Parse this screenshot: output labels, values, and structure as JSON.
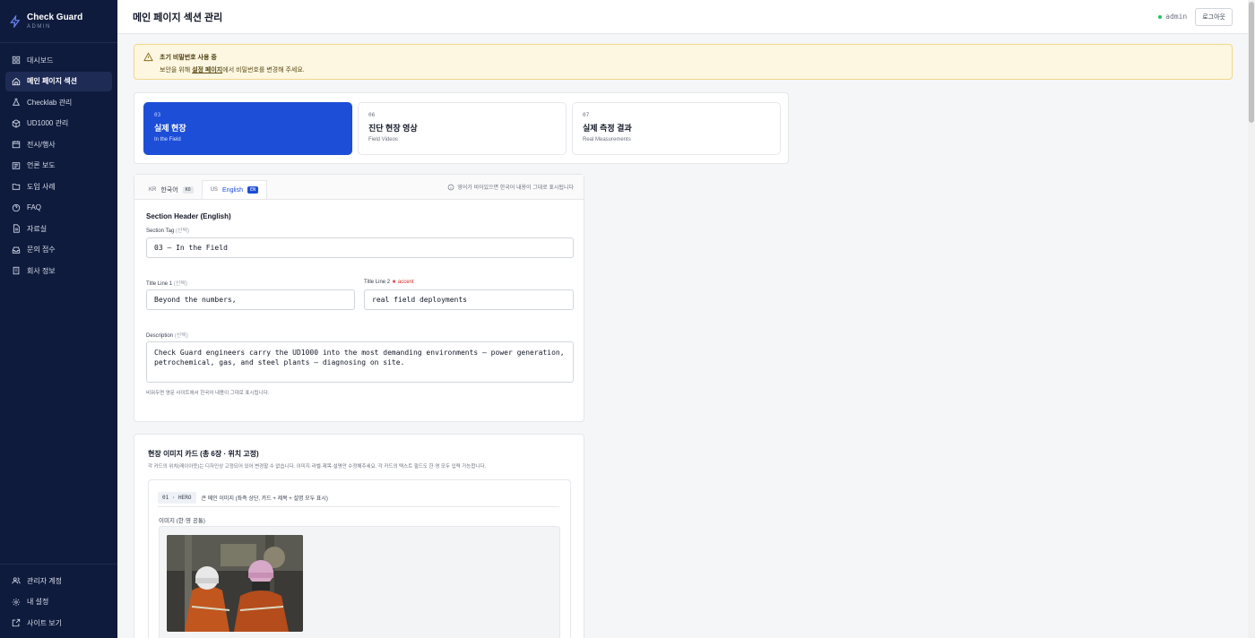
{
  "brand": {
    "name": "Check Guard",
    "role": "ADMIN"
  },
  "sidebar": {
    "items": [
      {
        "label": "대시보드",
        "icon": "dashboard-icon"
      },
      {
        "label": "메인 페이지 섹션",
        "icon": "home-icon",
        "active": true
      },
      {
        "label": "Checklab 관리",
        "icon": "flask-icon"
      },
      {
        "label": "UD1000 관리",
        "icon": "box-icon"
      },
      {
        "label": "전시/행사",
        "icon": "calendar-icon"
      },
      {
        "label": "언론 보도",
        "icon": "newspaper-icon"
      },
      {
        "label": "도입 사례",
        "icon": "folder-icon"
      },
      {
        "label": "FAQ",
        "icon": "help-circle-icon"
      },
      {
        "label": "자료실",
        "icon": "file-icon"
      },
      {
        "label": "문의 접수",
        "icon": "inbox-icon"
      },
      {
        "label": "회사 정보",
        "icon": "building-icon"
      }
    ],
    "bottom": [
      {
        "label": "관리자 계정",
        "icon": "users-icon"
      },
      {
        "label": "내 설정",
        "icon": "gear-icon"
      },
      {
        "label": "사이트 보기",
        "icon": "external-link-icon"
      }
    ]
  },
  "header": {
    "title": "메인 페이지 섹션 관리",
    "user": "admin",
    "logout": "로그아웃"
  },
  "alert": {
    "title": "초기 비밀번호 사용 중",
    "text_before": "보안을 위해 ",
    "link": "설정 페이지",
    "text_after": "에서 비밀번호를 변경해 주세요."
  },
  "section_tabs": [
    {
      "num": "03",
      "title": "실제 현장",
      "sub": "In the Field",
      "active": true
    },
    {
      "num": "06",
      "title": "진단 현장 영상",
      "sub": "Field Videos"
    },
    {
      "num": "07",
      "title": "실제 측정 결과",
      "sub": "Real Measurements"
    }
  ],
  "lang": {
    "tabs": [
      {
        "flag": "KR",
        "label": "한국어",
        "code": "KO"
      },
      {
        "flag": "US",
        "label": "English",
        "code": "EN",
        "active": true
      }
    ],
    "hint": "영어가 비어있으면 한국어 내용이 그대로 표시됩니다"
  },
  "form": {
    "section_header": "Section Header (English)",
    "tag_label": "Section Tag",
    "optional": "(선택)",
    "tag_value": "03 — In the Field",
    "title1_label": "Title Line 1",
    "title1_value": "Beyond the numbers,",
    "title2_label": "Title Line 2",
    "title2_req": "★ accent",
    "title2_value": "real field deployments",
    "desc_label": "Description",
    "desc_value": "Check Guard engineers carry the UD1000 into the most demanding environments — power generation, petrochemical, gas, and steel plants — diagnosing on site.",
    "help": "비워두면 영문 사이트에서 한국어 내용이 그대로 표시됩니다."
  },
  "image_cards": {
    "title": "현장 이미지 카드 (총 6장 · 위치 고정)",
    "desc": "각 카드의 위치(레이아웃)는 디자인상 고정되어 있어 변경할 수 없습니다. 이미지·라벨·제목·설명만 수정해주세요. 각 카드의 텍스트 필드도 한·영 모두 입력 가능합니다.",
    "card1": {
      "badge": "01 · HERO",
      "text": "큰 메인 이미지 (좌측 상단, 카드 + 제목 + 설명 모두 표시)",
      "image_label": "이미지 (한·영 공통)"
    }
  },
  "colors": {
    "sidebar": "#0f1b3d",
    "accent": "#1d4ed8",
    "alert_bg": "#fdf7e1"
  }
}
